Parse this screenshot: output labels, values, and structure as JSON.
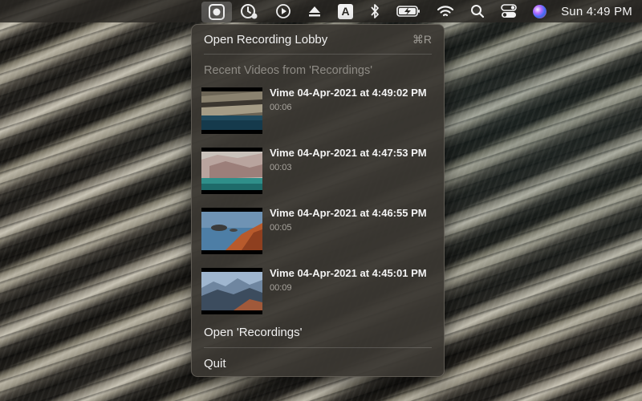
{
  "menubar": {
    "icons": [
      "screen-record-icon",
      "vime-status-icon",
      "play-circle-icon",
      "eject-icon",
      "input-source-icon",
      "bluetooth-icon",
      "battery-charging-icon",
      "wifi-icon",
      "search-icon",
      "control-center-icon",
      "siri-icon"
    ],
    "input_source_letter": "A",
    "clock": "Sun 4:49 PM"
  },
  "menu": {
    "open_lobby_label": "Open Recording Lobby",
    "open_lobby_shortcut": "⌘R",
    "recent_header": "Recent Videos from 'Recordings'",
    "videos": [
      {
        "title": "Vime 04-Apr-2021 at 4:49:02 PM",
        "duration": "00:06"
      },
      {
        "title": "Vime 04-Apr-2021 at 4:47:53 PM",
        "duration": "00:03"
      },
      {
        "title": "Vime 04-Apr-2021 at 4:46:55 PM",
        "duration": "00:05"
      },
      {
        "title": "Vime 04-Apr-2021 at 4:45:01 PM",
        "duration": "00:09"
      }
    ],
    "open_folder_label": "Open 'Recordings'",
    "quit_label": "Quit"
  },
  "colors": {
    "menu_bg": "#3a3732",
    "menu_text": "#f0f0f0",
    "disabled_text": "#8e8b85",
    "menubar_bg": "#282622"
  }
}
